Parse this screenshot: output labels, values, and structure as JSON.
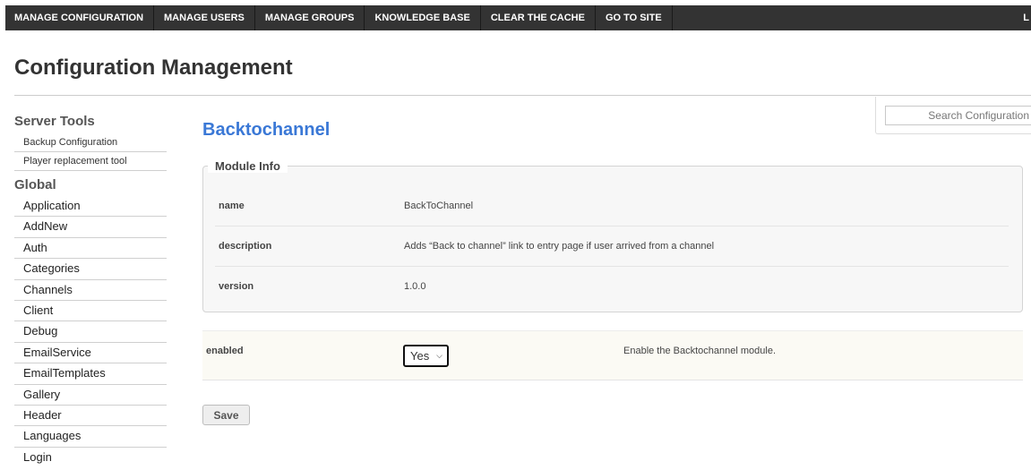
{
  "topnav": {
    "items": [
      "MANAGE CONFIGURATION",
      "MANAGE USERS",
      "MANAGE GROUPS",
      "KNOWLEDGE BASE",
      "CLEAR THE CACHE",
      "GO TO SITE"
    ],
    "right_text": "L"
  },
  "page": {
    "title": "Configuration Management"
  },
  "search": {
    "placeholder": "Search Configuration"
  },
  "sidebar": {
    "server_tools_heading": "Server Tools",
    "server_tools": [
      "Backup Configuration",
      "Player replacement tool"
    ],
    "global_heading": "Global",
    "global_items": [
      "Application",
      "AddNew",
      "Auth",
      "Categories",
      "Channels",
      "Client",
      "Debug",
      "EmailService",
      "EmailTemplates",
      "Gallery",
      "Header",
      "Languages",
      "Login"
    ]
  },
  "module": {
    "title": "Backtochannel",
    "legend": "Module Info",
    "info": [
      {
        "key": "name",
        "value": "BackToChannel"
      },
      {
        "key": "description",
        "value": "Adds “Back to channel” link to entry page if user arrived from a channel"
      },
      {
        "key": "version",
        "value": "1.0.0"
      }
    ]
  },
  "settings": {
    "enabled_label": "enabled",
    "enabled_value": "Yes",
    "enabled_description": "Enable the Backtochannel module."
  },
  "actions": {
    "save_label": "Save"
  }
}
